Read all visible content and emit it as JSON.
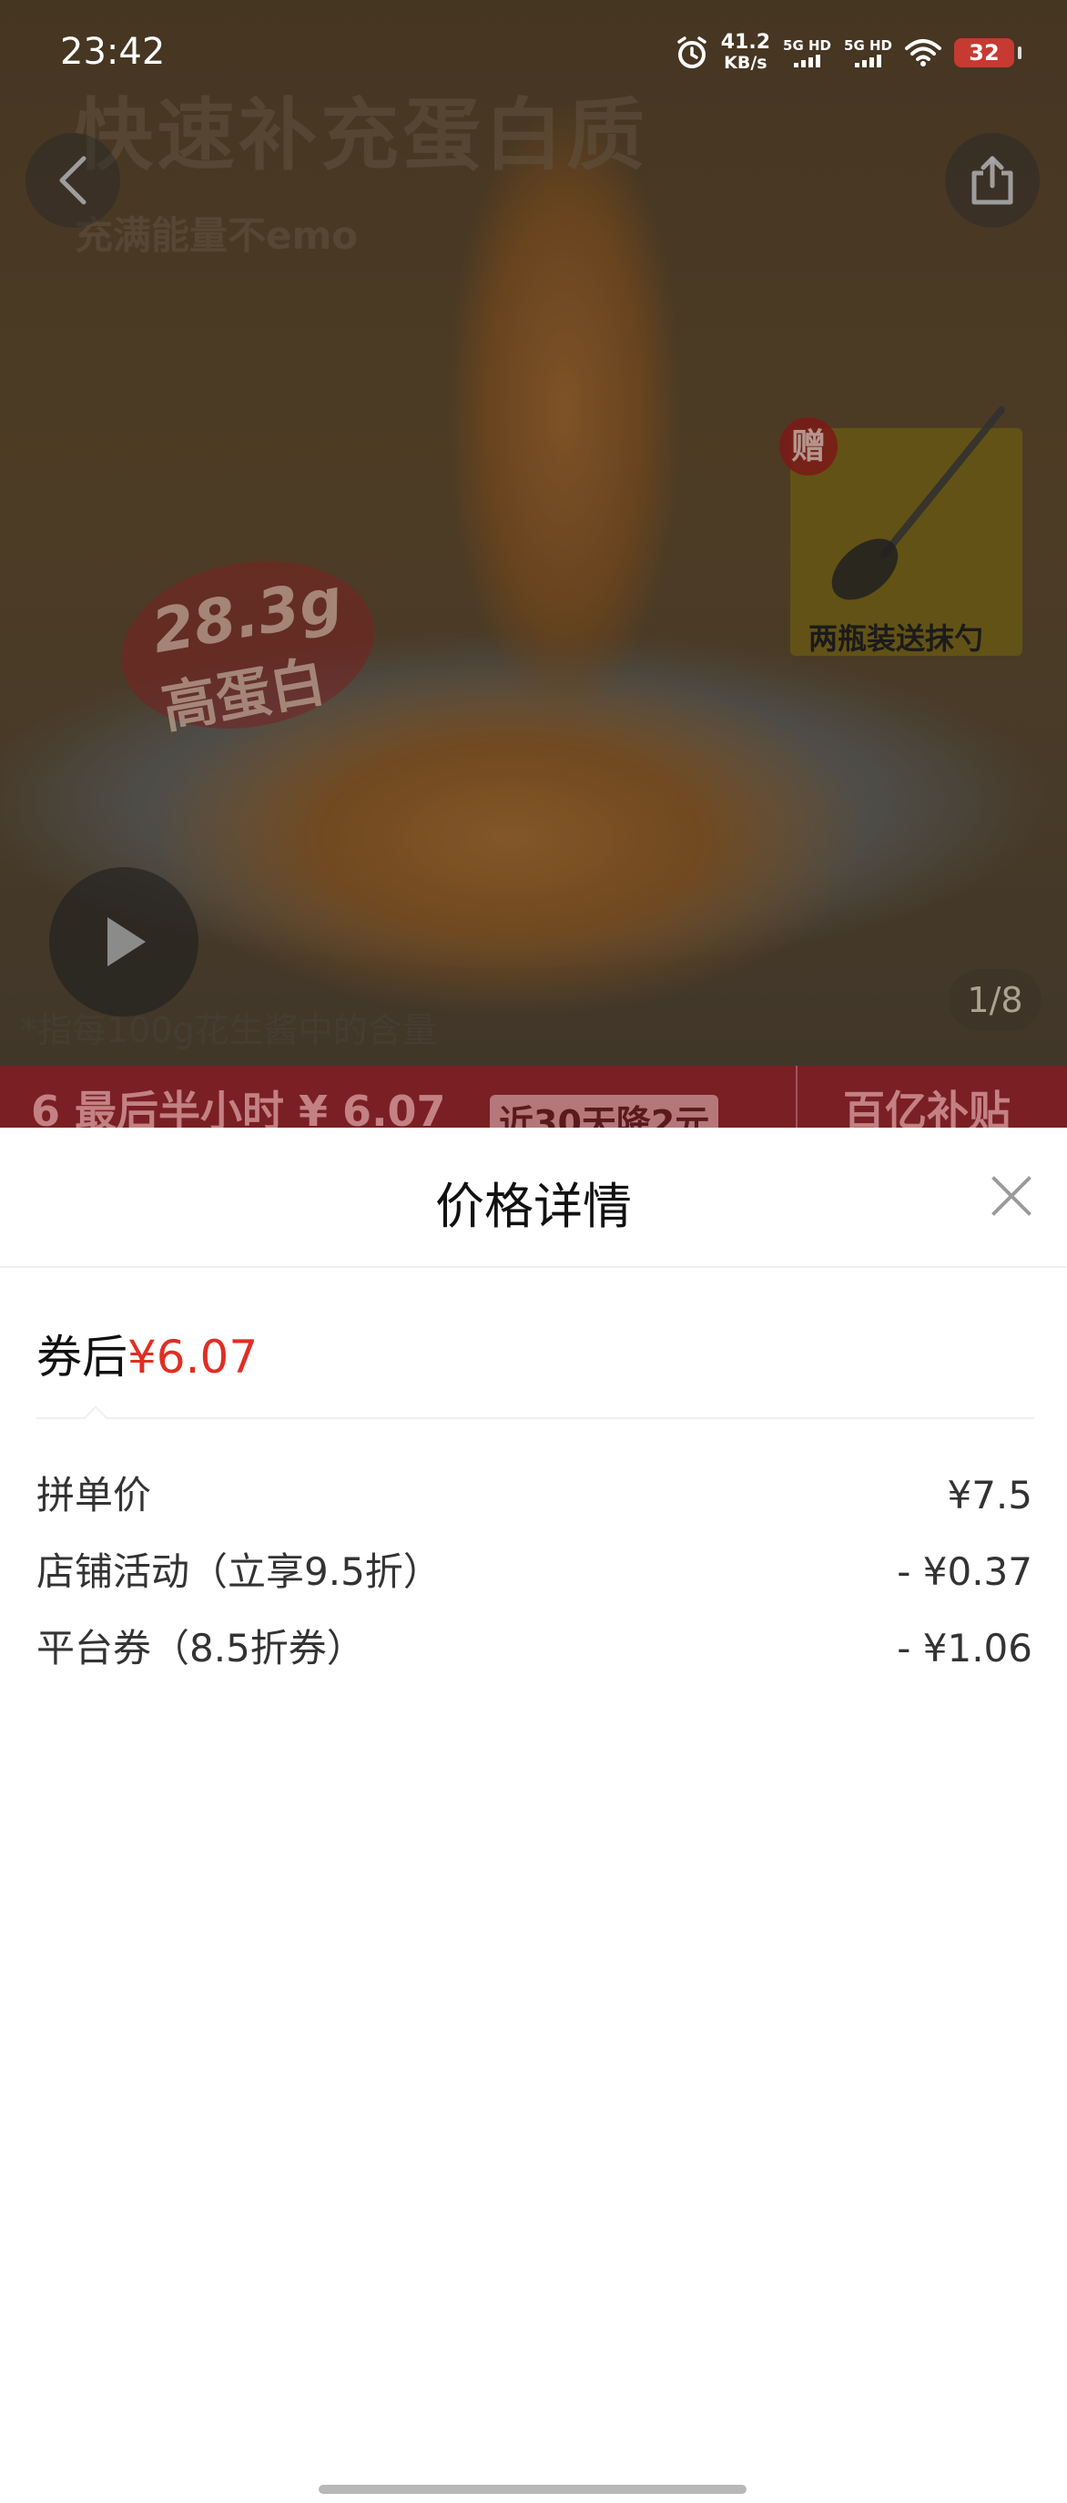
{
  "status_bar": {
    "time": "23:42",
    "net_speed_value": "41.2",
    "net_speed_unit": "KB/s",
    "sim1_label": "5G HD",
    "sim2_label": "5G HD",
    "battery": "32",
    "icons": [
      "alarm-icon",
      "signal-icon",
      "signal-icon",
      "wifi-icon",
      "battery-icon"
    ]
  },
  "product_image": {
    "headline": "快速补充蛋白质",
    "subline": "充满能量不emo",
    "badge_line1": "28.3g",
    "badge_line2": "高蛋白",
    "gift_tag": "赠",
    "gift_caption": "两瓶装送抹勺",
    "footnote": "*指每100g花生酱中的含量",
    "page_counter": "1/8"
  },
  "promo_strip": {
    "left_text": "6 最后半小时 ¥ 6.07",
    "tag": "近30天降2元",
    "right_text": "百亿补贴"
  },
  "price_sheet": {
    "title": "价格详情",
    "total_label": "券后",
    "total_amount": "¥6.07",
    "rows": [
      {
        "label": "拼单价",
        "value": "¥7.5"
      },
      {
        "label": "店铺活动（立享9.5折）",
        "value": "- ¥0.37"
      },
      {
        "label": "平台券（8.5折券）",
        "value": "- ¥1.06"
      }
    ]
  },
  "colors": {
    "price_red": "#e02e24",
    "promo_strip": "#7a1f24"
  }
}
